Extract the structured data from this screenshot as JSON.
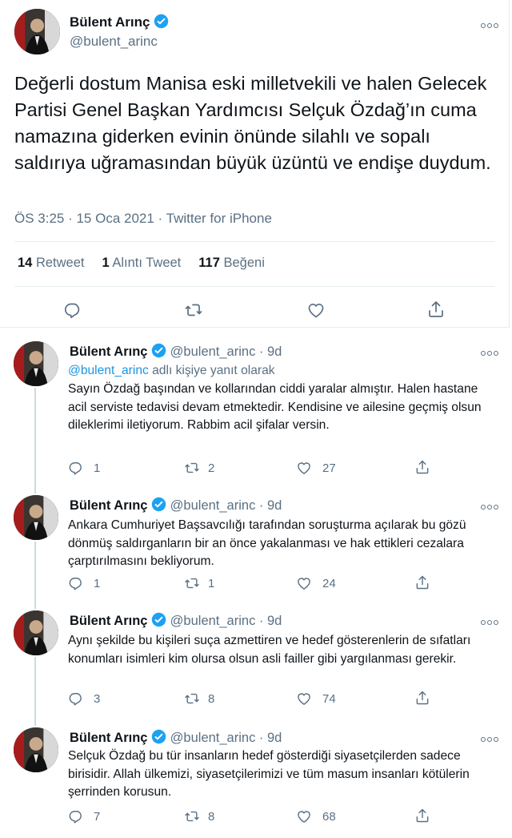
{
  "main_tweet": {
    "name": "Bülent Arınç",
    "handle": "@bulent_arinc",
    "text": "Değerli dostum Manisa eski milletvekili ve halen Gelecek Partisi Genel Başkan Yardımcısı Selçuk Özdağ’ın cuma namazına giderken evinin önünde silahlı ve sopalı saldırıya uğramasından büyük üzüntü ve endişe duydum.",
    "meta": "ÖS 3:25 · 15 Oca 2021 · Twitter for iPhone",
    "retweets_count": "14",
    "retweets_label": "Retweet",
    "quotes_count": "1",
    "quotes_label": "Alıntı Tweet",
    "likes_count": "117",
    "likes_label": "Beğeni"
  },
  "replies": [
    {
      "name": "Bülent Arınç",
      "handle": "@bulent_arinc",
      "time": "· 9d",
      "reply_to_handle": "@bulent_arinc",
      "reply_to_suffix": " adlı kişiye yanıt olarak",
      "text": "Sayın Özdağ başından ve kollarından ciddi yaralar almıştır. Halen hastane acil serviste tedavisi devam etmektedir. Kendisine ve ailesine geçmiş olsun dileklerimi iletiyorum. Rabbim acil şifalar versin.",
      "replies": "1",
      "retweets": "2",
      "likes": "27"
    },
    {
      "name": "Bülent Arınç",
      "handle": "@bulent_arinc",
      "time": "· 9d",
      "text": "Ankara Cumhuriyet Başsavcılığı tarafından soruşturma açılarak bu gözü dönmüş saldırganların bir an önce yakalanması ve hak ettikleri cezalara çarptırılmasını bekliyorum.",
      "replies": "1",
      "retweets": "1",
      "likes": "24"
    },
    {
      "name": "Bülent Arınç",
      "handle": "@bulent_arinc",
      "time": "· 9d",
      "text": "Aynı şekilde bu kişileri suça azmettiren ve hedef gösterenlerin de sıfatları konumları isimleri kim olursa olsun asli failler gibi yargılanması gerekir.",
      "replies": "3",
      "retweets": "8",
      "likes": "74"
    },
    {
      "name": "Bülent Arınç",
      "handle": "@bulent_arinc",
      "time": "· 9d",
      "text": "Selçuk Özdağ bu tür insanların hedef gösterdiği siyasetçilerden sadece birisidir. Allah ülkemizi, siyasetçilerimizi ve tüm masum insanları kötülerin şerrinden korusun.",
      "replies": "7",
      "retweets": "8",
      "likes": "68"
    }
  ],
  "icons": [
    "verified-badge-icon",
    "more-icon",
    "reply-icon",
    "retweet-icon",
    "like-icon",
    "share-icon"
  ],
  "colors": {
    "accent": "#1da1f2",
    "link": "#1b95e0",
    "muted": "#5b7083",
    "text": "#0f1419"
  }
}
